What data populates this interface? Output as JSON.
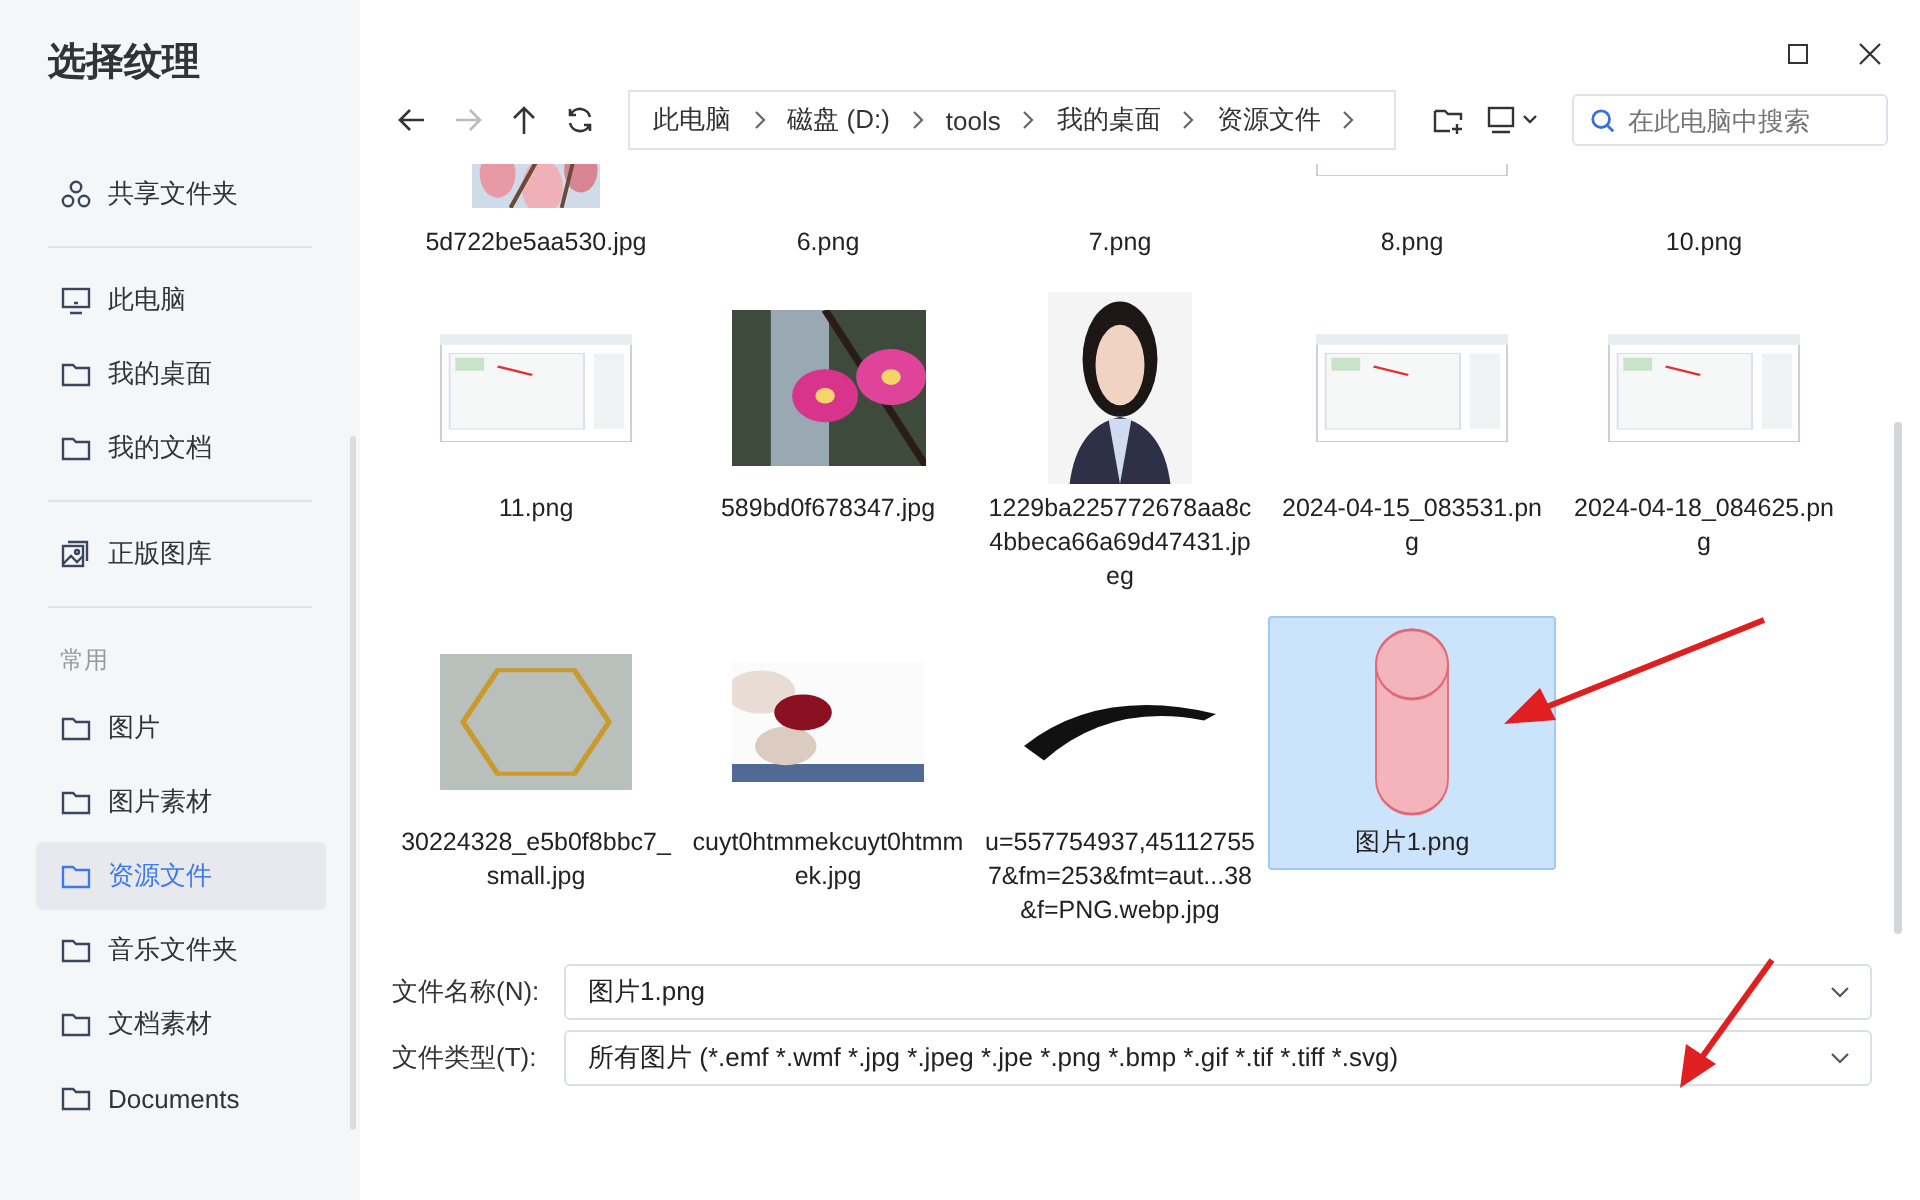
{
  "window": {
    "title": "选择纹理"
  },
  "sidebar": {
    "sections": [
      {
        "items": [
          {
            "label": "共享文件夹",
            "kind": "share",
            "selected": false
          }
        ]
      },
      {
        "items": [
          {
            "label": "此电脑",
            "kind": "monitor",
            "selected": false
          },
          {
            "label": "我的桌面",
            "kind": "folder",
            "selected": false
          },
          {
            "label": "我的文档",
            "kind": "folder",
            "selected": false
          }
        ]
      },
      {
        "items": [
          {
            "label": "正版图库",
            "kind": "gallery",
            "selected": false
          }
        ]
      },
      {
        "header": "常用",
        "items": [
          {
            "label": "图片",
            "kind": "folder",
            "selected": false
          },
          {
            "label": "图片素材",
            "kind": "folder",
            "selected": false
          },
          {
            "label": "资源文件",
            "kind": "folder",
            "selected": true
          },
          {
            "label": "音乐文件夹",
            "kind": "folder",
            "selected": false
          },
          {
            "label": "文档素材",
            "kind": "folder",
            "selected": false
          },
          {
            "label": "Documents",
            "kind": "folder",
            "selected": false
          }
        ]
      }
    ]
  },
  "toolbar": {
    "nav": [
      {
        "kind": "back",
        "disabled": false
      },
      {
        "kind": "forward",
        "disabled": true
      },
      {
        "kind": "up",
        "disabled": false
      },
      {
        "kind": "refresh",
        "disabled": false
      }
    ],
    "breadcrumb": [
      "此电脑",
      "磁盘 (D:)",
      "tools",
      "我的桌面",
      "资源文件"
    ],
    "search": {
      "placeholder": "在此电脑中搜索"
    }
  },
  "files": [
    {
      "name": "5d722be5aa530.jpg",
      "kind": "blossom",
      "selected": false
    },
    {
      "name": "6.png",
      "selected": false
    },
    {
      "name": "7.png",
      "selected": false
    },
    {
      "name": "8.png",
      "kind": "sheet",
      "selected": false
    },
    {
      "name": "10.png",
      "selected": false
    },
    {
      "name": "11.png",
      "kind": "sheet",
      "selected": false
    },
    {
      "name": "589bd0f678347.jpg",
      "kind": "flower",
      "selected": false
    },
    {
      "name": "1229ba225772678aa8c4bbeca66a69d47431.jpeg",
      "kind": "portrait",
      "selected": false
    },
    {
      "name": "2024-04-15_083531.png",
      "kind": "sheet",
      "selected": false
    },
    {
      "name": "2024-04-18_084625.png",
      "kind": "sheet",
      "selected": false
    },
    {
      "name": "30224328_e5b0f8bbc7_small.jpg",
      "kind": "frame",
      "selected": false
    },
    {
      "name": "cuyt0htmmekcuyt0htmmek.jpg",
      "kind": "balloons",
      "selected": false
    },
    {
      "name": "u=557754937,451127557&fm=253&fmt=aut...38&f=PNG.webp.jpg",
      "kind": "brush",
      "selected": false
    },
    {
      "name": "图片1.png",
      "kind": "cylinder",
      "selected": true
    }
  ],
  "fields": [
    {
      "label": "文件名称(N):",
      "value": "图片1.png"
    },
    {
      "label": "文件类型(T):",
      "value": "所有图片 (*.emf *.wmf *.jpg *.jpeg *.jpe *.png *.bmp *.gif *.tif *.tiff *.svg)"
    }
  ]
}
